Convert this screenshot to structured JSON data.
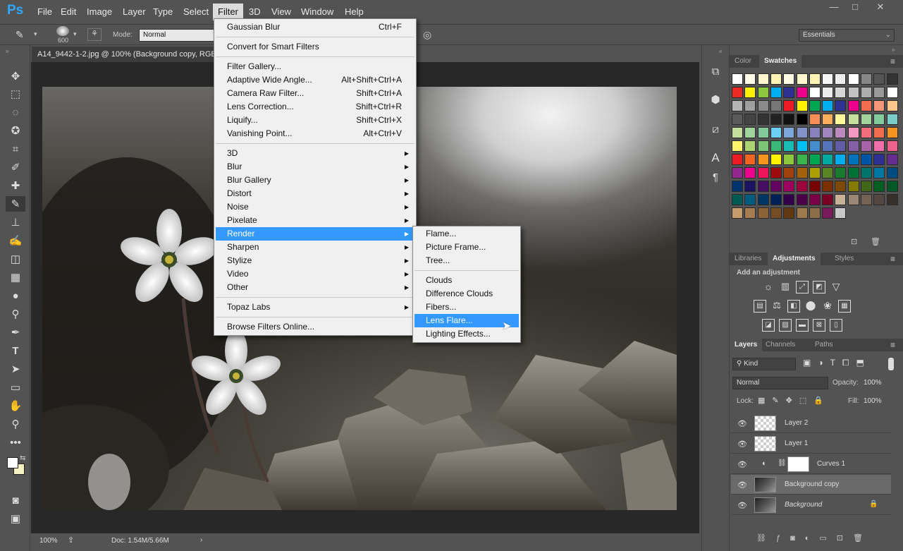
{
  "app": {
    "logo": "Ps",
    "workspace": "Essentials"
  },
  "menubar": [
    "File",
    "Edit",
    "Image",
    "Layer",
    "Type",
    "Select",
    "Filter",
    "3D",
    "View",
    "Window",
    "Help"
  ],
  "window_controls": [
    "—",
    "□",
    "✕"
  ],
  "options": {
    "brush_size": "600",
    "mode_label": "Mode:",
    "mode_value": "Normal"
  },
  "document": {
    "tab_title": "A14_9442-1-2.jpg @ 100% (Background copy, RGB/8)",
    "zoom": "100%",
    "doc_info": "Doc: 1.54M/5.66M"
  },
  "filter_menu": [
    {
      "label": "Gaussian Blur",
      "shortcut": "Ctrl+F"
    },
    {
      "sep": true
    },
    {
      "label": "Convert for Smart Filters"
    },
    {
      "sep": true
    },
    {
      "label": "Filter Gallery..."
    },
    {
      "label": "Adaptive Wide Angle...",
      "shortcut": "Alt+Shift+Ctrl+A"
    },
    {
      "label": "Camera Raw Filter...",
      "shortcut": "Shift+Ctrl+A"
    },
    {
      "label": "Lens Correction...",
      "shortcut": "Shift+Ctrl+R"
    },
    {
      "label": "Liquify...",
      "shortcut": "Shift+Ctrl+X"
    },
    {
      "label": "Vanishing Point...",
      "shortcut": "Alt+Ctrl+V"
    },
    {
      "sep": true
    },
    {
      "label": "3D",
      "sub": true
    },
    {
      "label": "Blur",
      "sub": true
    },
    {
      "label": "Blur Gallery",
      "sub": true
    },
    {
      "label": "Distort",
      "sub": true
    },
    {
      "label": "Noise",
      "sub": true
    },
    {
      "label": "Pixelate",
      "sub": true
    },
    {
      "label": "Render",
      "sub": true,
      "highlighted": true
    },
    {
      "label": "Sharpen",
      "sub": true
    },
    {
      "label": "Stylize",
      "sub": true
    },
    {
      "label": "Video",
      "sub": true
    },
    {
      "label": "Other",
      "sub": true
    },
    {
      "sep": true
    },
    {
      "label": "Topaz Labs",
      "sub": true
    },
    {
      "sep": true
    },
    {
      "label": "Browse Filters Online..."
    }
  ],
  "render_submenu": [
    {
      "label": "Flame..."
    },
    {
      "label": "Picture Frame..."
    },
    {
      "label": "Tree..."
    },
    {
      "sep": true
    },
    {
      "label": "Clouds"
    },
    {
      "label": "Difference Clouds"
    },
    {
      "label": "Fibers..."
    },
    {
      "label": "Lens Flare...",
      "highlighted": true
    },
    {
      "label": "Lighting Effects..."
    }
  ],
  "color_panel": {
    "tabs": [
      "Color",
      "Swatches"
    ],
    "active": "Swatches"
  },
  "swatch_rows": [
    [
      "#ffffff",
      "#fffbe6",
      "#fff7cc",
      "#fff3b3",
      "#fffbe6",
      "#fff7cc",
      "#fff3b3",
      "#f6f6f6",
      "#eeeeee",
      "#ffffff",
      "#888888",
      "#555555",
      "#333333"
    ],
    [
      "#ee2a24",
      "#fff200",
      "#8dc63f",
      "#00aeef",
      "#2e3192",
      "#ec008c",
      "#ffffff",
      "#ebebeb",
      "#d7d7d7",
      "#c2c2c2",
      "#adadad",
      "#999999",
      "#ffffff"
    ],
    [
      "#b5b5b5",
      "#a0a0a0",
      "#8a8a8a",
      "#777777",
      "#ee1c24",
      "#fff200",
      "#00a651",
      "#00aeef",
      "#2e3192",
      "#ec008c",
      "#f26c4f",
      "#f7977a",
      "#fdc68a"
    ],
    [
      "#5a5a5a",
      "#444444",
      "#333333",
      "#222222",
      "#111111",
      "#000000",
      "#f68e56",
      "#fbaf5d",
      "#fff799",
      "#c4df9b",
      "#a3d39c",
      "#82ca9c",
      "#7accc8"
    ],
    [
      "#c4df9b",
      "#a3d39c",
      "#82ca9c",
      "#6dcff6",
      "#7da7d9",
      "#8393ca",
      "#8781bd",
      "#a186be",
      "#bd8cbf",
      "#f49ac2",
      "#f26d7d",
      "#f26c4f",
      "#f7941d"
    ],
    [
      "#fff568",
      "#acd373",
      "#7cc576",
      "#3bb878",
      "#1abbb4",
      "#00bff3",
      "#448ccb",
      "#5574b9",
      "#605ca8",
      "#855fa8",
      "#a864a8",
      "#f06eaa",
      "#f0618e"
    ],
    [
      "#ed1c24",
      "#f26522",
      "#f7941d",
      "#fff200",
      "#8dc63f",
      "#39b54a",
      "#00a651",
      "#00a99d",
      "#00aeef",
      "#0072bc",
      "#0054a6",
      "#2e3192",
      "#662d91"
    ],
    [
      "#92278f",
      "#ec008c",
      "#ed145b",
      "#9e0b0f",
      "#a0410d",
      "#a36209",
      "#aba000",
      "#598527",
      "#1a7b30",
      "#007236",
      "#00746b",
      "#0076a3",
      "#004b80"
    ],
    [
      "#003471",
      "#1b1464",
      "#440e62",
      "#630460",
      "#9e005d",
      "#9e0039",
      "#790000",
      "#7b2e00",
      "#7d4900",
      "#827b00",
      "#406618",
      "#005e20",
      "#005826"
    ],
    [
      "#005952",
      "#005b7f",
      "#003663",
      "#002157",
      "#32004b",
      "#4b0049",
      "#7b0046",
      "#7a0026",
      "#c7b299",
      "#998675",
      "#736357",
      "#534741",
      "#37302a"
    ],
    [
      "#c69c6d",
      "#a67c52",
      "#8c6239",
      "#754c24",
      "#603913",
      "#9e7b4d",
      "#8d6e4a",
      "#7a1a5c",
      "#c8c8c8"
    ]
  ],
  "adjustments": {
    "tabs": [
      "Libraries",
      "Adjustments",
      "Styles"
    ],
    "active": "Adjustments",
    "title": "Add an adjustment"
  },
  "layers_panel": {
    "tabs": [
      "Layers",
      "Channels",
      "Paths"
    ],
    "kind_label": "Kind",
    "blend_mode": "Normal",
    "opacity_label": "Opacity:",
    "opacity": "100%",
    "lock_label": "Lock:",
    "fill_label": "Fill:",
    "fill": "100%",
    "layers": [
      {
        "name": "Layer 2",
        "type": "empty"
      },
      {
        "name": "Layer 1",
        "type": "empty"
      },
      {
        "name": "Curves 1",
        "type": "adjustment"
      },
      {
        "name": "Background copy",
        "type": "photo",
        "selected": true
      },
      {
        "name": "Background",
        "type": "photo",
        "locked": true,
        "italic": true
      }
    ]
  }
}
